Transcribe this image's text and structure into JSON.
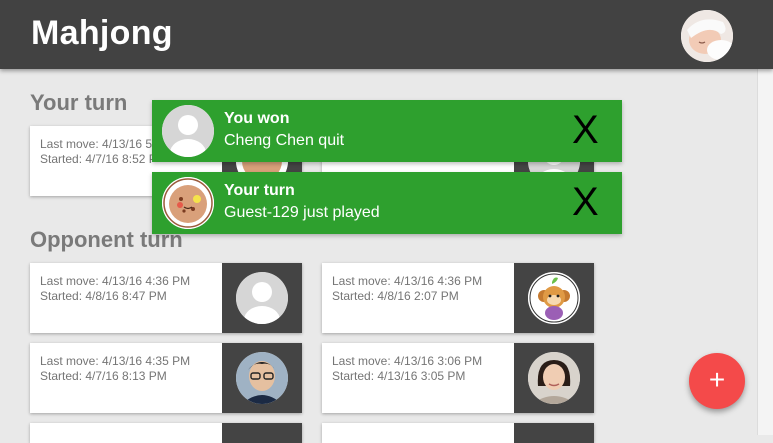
{
  "app": {
    "title": "Mahjong"
  },
  "sections": {
    "your_turn": "Your turn",
    "opponent_turn": "Opponent turn"
  },
  "your_turn_cards": [
    {
      "last_move": "Last move: 4/13/16 5",
      "started": "Started: 4/7/16 8:52 P"
    },
    {
      "last_move": "",
      "started": ""
    }
  ],
  "opponent_cards": [
    {
      "last_move": "Last move: 4/13/16 4:36 PM",
      "started": "Started: 4/8/16 8:47 PM",
      "avatar": "default-person-icon"
    },
    {
      "last_move": "Last move: 4/13/16 4:36 PM",
      "started": "Started: 4/8/16 2:07 PM",
      "avatar": "monkey-avatar"
    },
    {
      "last_move": "Last move: 4/13/16 4:35 PM",
      "started": "Started: 4/7/16 8:13 PM",
      "avatar": "man-with-glasses-photo"
    },
    {
      "last_move": "Last move: 4/13/16 3:06 PM",
      "started": "Started: 4/13/16 3:05 PM",
      "avatar": "woman-photo"
    }
  ],
  "notifications": [
    {
      "title": "You won",
      "message": "Cheng Chen quit",
      "close": "X",
      "avatar": "default-person-icon"
    },
    {
      "title": "Your turn",
      "message": "Guest-129 just played",
      "close": "X",
      "avatar": "cookie-avatar"
    }
  ],
  "fab": {
    "label": "+"
  },
  "colors": {
    "appbar": "#424242",
    "toast": "#2ea02e",
    "fab": "#f44a4a",
    "card_image_bg": "#444444"
  }
}
